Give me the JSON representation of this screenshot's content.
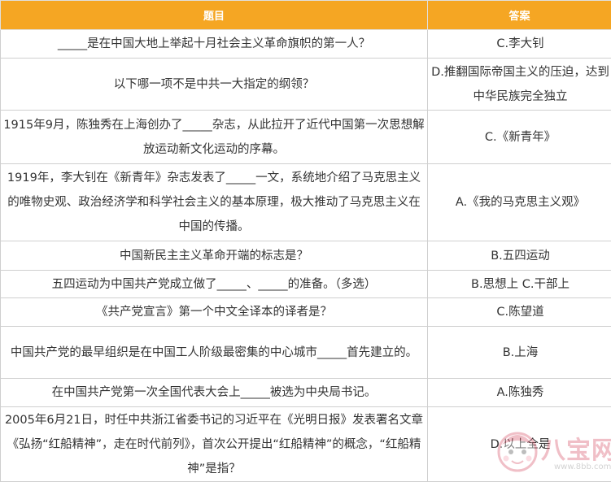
{
  "table": {
    "headers": {
      "question": "题目",
      "answer": "答案"
    },
    "rows": [
      {
        "question": "_____是在中国大地上举起十月社会主义革命旗帜的第一人？",
        "answer": "C.李大钊"
      },
      {
        "question": "以下哪一项不是中共一大指定的纲领？",
        "answer": "D.推翻国际帝国主义的压迫，达到中华民族完全独立"
      },
      {
        "question": "1915年9月，陈独秀在上海创办了_____杂志，从此拉开了近代中国第一次思想解放运动新文化运动的序幕。",
        "answer": "C.《新青年》"
      },
      {
        "question": "1919年，李大钊在《新青年》杂志发表了_____一文，系统地介绍了马克思主义的唯物史观、政治经济学和科学社会主义的基本原理，极大推动了马克思主义在中国的传播。",
        "answer": "A.《我的马克思主义观》"
      },
      {
        "question": "中国新民主主义革命开端的标志是？",
        "answer": "B.五四运动"
      },
      {
        "question": "五四运动为中国共产党成立做了_____、_____的准备。（多选）",
        "answer": "B.思想上 C.干部上"
      },
      {
        "question": "《共产党宣言》第一个中文全译本的译者是？",
        "answer": "C.陈望道"
      },
      {
        "question": "中国共产党的最早组织是在中国工人阶级最密集的中心城市_____首先建立的。",
        "answer": "B.上海"
      },
      {
        "question": "在中国共产党第一次全国代表大会上_____被选为中央局书记。",
        "answer": "A.陈独秀"
      },
      {
        "question": "2005年6月21日，时任中共浙江省委书记的习近平在《光明日报》发表署名文章《弘扬“红船精神”，走在时代前列》，首次公开提出“红船精神”的概念，“红船精神”是指？",
        "answer": "D.以上全是"
      }
    ]
  },
  "watermark": {
    "title": "八宝网",
    "url": "www.8bb.com"
  },
  "colors": {
    "header_bg": "#f5a623",
    "header_text": "#ffffff",
    "border": "#cfcfcf",
    "text": "#333333",
    "watermark": "#d9586f"
  }
}
